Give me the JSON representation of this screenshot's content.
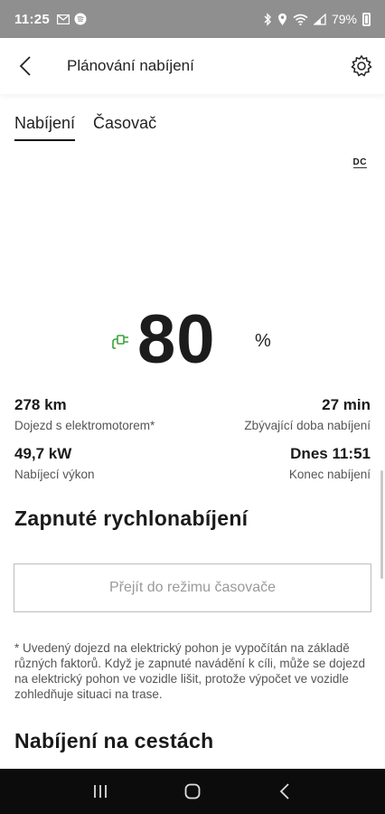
{
  "status_bar": {
    "time": "11:25",
    "battery": "79%",
    "icons_left": [
      "gmail-icon",
      "spotify-icon"
    ],
    "icons_right": [
      "bluetooth-icon",
      "location-icon",
      "wifi-icon",
      "signal-icon",
      "battery-icon"
    ]
  },
  "header": {
    "title": "Plánování nabíjení",
    "back_icon": "back-arrow-icon",
    "settings_icon": "gear-icon"
  },
  "tabs": [
    {
      "label": "Nabíjení",
      "active": true
    },
    {
      "label": "Časovač",
      "active": false
    }
  ],
  "charge_mode": "DC",
  "charge": {
    "percent": "80",
    "unit": "%",
    "bar_color": "#3aa33a",
    "plug_icon": "plug-icon"
  },
  "stats": {
    "range_value": "278 km",
    "range_label": "Dojezd s elektromotorem*",
    "remaining_value": "27 min",
    "remaining_label": "Zbývající doba nabíjení",
    "power_value": "49,7 kW",
    "power_label": "Nabíjecí výkon",
    "end_value": "Dnes 11:51",
    "end_label": "Konec nabíjení"
  },
  "fast_charging_title": "Zapnuté rychlonabíjení",
  "timer_button_label": "Přejít do režimu časovače",
  "footnote": "* Uvedený dojezd na elektrický pohon je vypočítán na základě různých faktorů. Když je zapnuté navádění k cíli, může se dojezd na elektrický pohon ve vozidle lišit, protože výpočet ve vozidle zohledňuje situaci na trase.",
  "on_road_title": "Nabíjení na cestách",
  "navbar": {
    "icons": [
      "recent-apps-icon",
      "home-icon",
      "back-icon"
    ]
  }
}
